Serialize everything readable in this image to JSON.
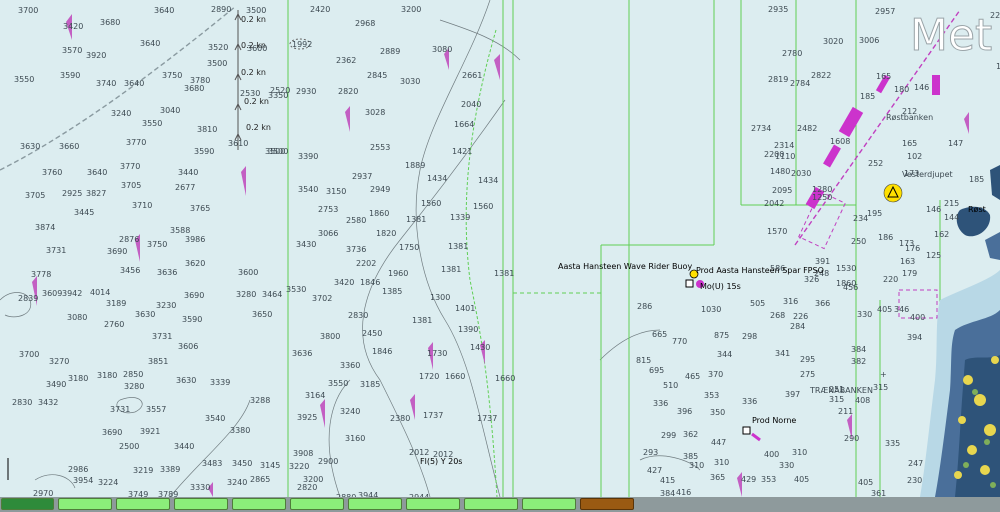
{
  "map": {
    "watermark": "Met",
    "features": {
      "buoy_label": "Aasta Hansteen Wave Rider Buoy",
      "fpso_label": "Prod Aasta Hansteen Spar FPSO",
      "light_label": "Mo(U)  15s",
      "norne_label": "Prod Norne",
      "light2_label": "Fl(5) Y 20s",
      "bank1": "Røstbanken",
      "bank2": "Vesterdjupet",
      "bank3": "TRÆNABANKEN",
      "rost": "Røst",
      "area_1992": "1992"
    },
    "currents": [
      "0.2 kn",
      "0.2 kn",
      "0.2 kn",
      "0.2 kn",
      "0.2 kn"
    ],
    "soundings": [
      [
        "3700",
        18,
        7
      ],
      [
        "3680",
        100,
        19
      ],
      [
        "3640",
        154,
        7
      ],
      [
        "2890",
        211,
        6
      ],
      [
        "3420",
        63,
        23
      ],
      [
        "3570",
        62,
        47
      ],
      [
        "3920",
        86,
        52
      ],
      [
        "3640",
        140,
        40
      ],
      [
        "3520",
        208,
        44
      ],
      [
        "3500",
        207,
        60
      ],
      [
        "3550",
        14,
        76
      ],
      [
        "3590",
        60,
        72
      ],
      [
        "3740",
        96,
        80
      ],
      [
        "3640",
        124,
        80
      ],
      [
        "3750",
        162,
        72
      ],
      [
        "3780",
        190,
        77
      ],
      [
        "3680",
        184,
        85
      ],
      [
        "2930",
        296,
        88
      ],
      [
        "2820",
        338,
        88
      ],
      [
        "3028",
        365,
        109
      ],
      [
        "2968",
        355,
        20
      ],
      [
        "3200",
        401,
        6
      ],
      [
        "2420",
        310,
        6
      ],
      [
        "2362",
        336,
        57
      ],
      [
        "2889",
        380,
        48
      ],
      [
        "2845",
        367,
        72
      ],
      [
        "3030",
        400,
        78
      ],
      [
        "3080",
        432,
        46
      ],
      [
        "2661",
        462,
        72
      ],
      [
        "2040",
        461,
        101
      ],
      [
        "1664",
        454,
        121
      ],
      [
        "1421",
        452,
        148
      ],
      [
        "1434",
        478,
        177
      ],
      [
        "1434",
        427,
        175
      ],
      [
        "1889",
        405,
        162
      ],
      [
        "2553",
        370,
        144
      ],
      [
        "3390",
        298,
        153
      ],
      [
        "3500",
        268,
        148
      ],
      [
        "3540",
        298,
        186
      ],
      [
        "3150",
        326,
        188
      ],
      [
        "2949",
        370,
        186
      ],
      [
        "2937",
        352,
        173
      ],
      [
        "1560",
        421,
        200
      ],
      [
        "1339",
        450,
        214
      ],
      [
        "1560",
        473,
        203
      ],
      [
        "1381",
        406,
        216
      ],
      [
        "1860",
        369,
        210
      ],
      [
        "2753",
        318,
        206
      ],
      [
        "2580",
        346,
        217
      ],
      [
        "1820",
        376,
        230
      ],
      [
        "3066",
        318,
        230
      ],
      [
        "3430",
        296,
        241
      ],
      [
        "3736",
        346,
        246
      ],
      [
        "1750",
        399,
        244
      ],
      [
        "1381",
        448,
        243
      ],
      [
        "2202",
        356,
        260
      ],
      [
        "1960",
        388,
        270
      ],
      [
        "1381",
        441,
        266
      ],
      [
        "1381",
        494,
        270
      ],
      [
        "3420",
        334,
        279
      ],
      [
        "1846",
        360,
        279
      ],
      [
        "1385",
        382,
        288
      ],
      [
        "3702",
        312,
        295
      ],
      [
        "1300",
        430,
        294
      ],
      [
        "2830",
        348,
        312
      ],
      [
        "1401",
        455,
        305
      ],
      [
        "1381",
        412,
        317
      ],
      [
        "2450",
        362,
        330
      ],
      [
        "1390",
        458,
        326
      ],
      [
        "3800",
        320,
        333
      ],
      [
        "1846",
        372,
        348
      ],
      [
        "1430",
        470,
        344
      ],
      [
        "3636",
        292,
        350
      ],
      [
        "3360",
        340,
        362
      ],
      [
        "1730",
        427,
        350
      ],
      [
        "1720",
        419,
        373
      ],
      [
        "1660",
        445,
        373
      ],
      [
        "1660",
        495,
        375
      ],
      [
        "3550",
        328,
        380
      ],
      [
        "3185",
        360,
        381
      ],
      [
        "3164",
        305,
        392
      ],
      [
        "2380",
        390,
        415
      ],
      [
        "1737",
        423,
        412
      ],
      [
        "1737",
        477,
        415
      ],
      [
        "3925",
        297,
        414
      ],
      [
        "3240",
        340,
        408
      ],
      [
        "3160",
        345,
        435
      ],
      [
        "2012",
        409,
        449
      ],
      [
        "2012",
        433,
        451
      ],
      [
        "3908",
        293,
        450
      ],
      [
        "2900",
        318,
        458
      ],
      [
        "3500",
        246,
        7
      ],
      [
        "3600",
        247,
        45
      ],
      [
        "2520",
        270,
        87
      ],
      [
        "2530",
        240,
        90
      ],
      [
        "3350",
        268,
        92
      ],
      [
        "3040",
        160,
        107
      ],
      [
        "3550",
        142,
        120
      ],
      [
        "3810",
        197,
        126
      ],
      [
        "3240",
        111,
        110
      ],
      [
        "3590",
        194,
        148
      ],
      [
        "3610",
        228,
        140
      ],
      [
        "3770",
        126,
        139
      ],
      [
        "3630",
        20,
        143
      ],
      [
        "3660",
        59,
        143
      ],
      [
        "3500",
        265,
        148
      ],
      [
        "3760",
        42,
        169
      ],
      [
        "3640",
        87,
        169
      ],
      [
        "3770",
        120,
        163
      ],
      [
        "3440",
        178,
        169
      ],
      [
        "3705",
        121,
        182
      ],
      [
        "2677",
        175,
        184
      ],
      [
        "2925",
        62,
        190
      ],
      [
        "3827",
        86,
        190
      ],
      [
        "3705",
        25,
        192
      ],
      [
        "3710",
        132,
        202
      ],
      [
        "3765",
        190,
        205
      ],
      [
        "3445",
        74,
        209
      ],
      [
        "3874",
        35,
        224
      ],
      [
        "3588",
        170,
        227
      ],
      [
        "2876",
        119,
        236
      ],
      [
        "3750",
        147,
        241
      ],
      [
        "3986",
        185,
        236
      ],
      [
        "3731",
        46,
        247
      ],
      [
        "3690",
        107,
        248
      ],
      [
        "3620",
        185,
        260
      ],
      [
        "3600",
        238,
        269
      ],
      [
        "3456",
        120,
        267
      ],
      [
        "3636",
        157,
        269
      ],
      [
        "3778",
        31,
        271
      ],
      [
        "3690",
        184,
        292
      ],
      [
        "3280",
        236,
        291
      ],
      [
        "3464",
        262,
        291
      ],
      [
        "3942",
        62,
        290
      ],
      [
        "4014",
        90,
        289
      ],
      [
        "2839",
        18,
        295
      ],
      [
        "3609",
        42,
        290
      ],
      [
        "3189",
        106,
        300
      ],
      [
        "3230",
        156,
        302
      ],
      [
        "3080",
        67,
        314
      ],
      [
        "2760",
        104,
        321
      ],
      [
        "3630",
        135,
        311
      ],
      [
        "3590",
        182,
        316
      ],
      [
        "3650",
        252,
        311
      ],
      [
        "3530",
        286,
        286
      ],
      [
        "3731",
        152,
        333
      ],
      [
        "3606",
        178,
        343
      ],
      [
        "3700",
        19,
        351
      ],
      [
        "3270",
        49,
        358
      ],
      [
        "3180",
        68,
        375
      ],
      [
        "3851",
        148,
        358
      ],
      [
        "3490",
        46,
        381
      ],
      [
        "3630",
        176,
        377
      ],
      [
        "3339",
        210,
        379
      ],
      [
        "2850",
        123,
        371
      ],
      [
        "3180",
        97,
        372
      ],
      [
        "2830",
        12,
        399
      ],
      [
        "3432",
        38,
        399
      ],
      [
        "3280",
        124,
        383
      ],
      [
        "3288",
        250,
        397
      ],
      [
        "3731",
        110,
        406
      ],
      [
        "3557",
        146,
        406
      ],
      [
        "3540",
        205,
        415
      ],
      [
        "3921",
        140,
        428
      ],
      [
        "3380",
        230,
        427
      ],
      [
        "3690",
        102,
        429
      ],
      [
        "2500",
        119,
        443
      ],
      [
        "3440",
        174,
        443
      ],
      [
        "3483",
        202,
        460
      ],
      [
        "3450",
        232,
        460
      ],
      [
        "3145",
        260,
        462
      ],
      [
        "3220",
        289,
        463
      ],
      [
        "3219",
        133,
        467
      ],
      [
        "3389",
        160,
        466
      ],
      [
        "3240",
        227,
        479
      ],
      [
        "2986",
        68,
        466
      ],
      [
        "3954",
        73,
        477
      ],
      [
        "3224",
        98,
        479
      ],
      [
        "3749",
        128,
        491
      ],
      [
        "3789",
        158,
        491
      ],
      [
        "3330",
        190,
        484
      ],
      [
        "2970",
        33,
        490
      ],
      [
        "2820",
        297,
        484
      ],
      [
        "2880",
        336,
        494
      ],
      [
        "3944",
        358,
        492
      ],
      [
        "2944",
        409,
        494
      ],
      [
        "2865",
        250,
        476
      ],
      [
        "3200",
        303,
        476
      ],
      [
        "2935",
        768,
        6
      ],
      [
        "2780",
        782,
        50
      ],
      [
        "3020",
        823,
        38
      ],
      [
        "3006",
        859,
        37
      ],
      [
        "2957",
        875,
        8
      ],
      [
        "2819",
        768,
        76
      ],
      [
        "2822",
        811,
        72
      ],
      [
        "2784",
        790,
        80
      ],
      [
        "2734",
        751,
        125
      ],
      [
        "2482",
        797,
        125
      ],
      [
        "2314",
        774,
        142
      ],
      [
        "2200",
        764,
        151
      ],
      [
        "1480",
        770,
        168
      ],
      [
        "2030",
        791,
        170
      ],
      [
        "1608",
        830,
        138
      ],
      [
        "1280",
        812,
        186
      ],
      [
        "1250",
        812,
        194
      ],
      [
        "2095",
        772,
        187
      ],
      [
        "2042",
        764,
        200
      ],
      [
        "1570",
        767,
        228
      ],
      [
        "1110",
        775,
        153
      ],
      [
        "1530",
        836,
        265
      ],
      [
        "1860",
        836,
        280
      ],
      [
        "391",
        815,
        258
      ],
      [
        "234",
        853,
        215
      ],
      [
        "250",
        851,
        238
      ],
      [
        "248",
        814,
        270
      ],
      [
        "326",
        804,
        276
      ],
      [
        "586",
        770,
        265
      ],
      [
        "456",
        843,
        284
      ],
      [
        "316",
        783,
        298
      ],
      [
        "366",
        815,
        300
      ],
      [
        "286",
        637,
        303
      ],
      [
        "505",
        750,
        300
      ],
      [
        "1030",
        701,
        306
      ],
      [
        "268",
        770,
        312
      ],
      [
        "226",
        793,
        313
      ],
      [
        "284",
        790,
        323
      ],
      [
        "330",
        857,
        311
      ],
      [
        "405",
        877,
        306
      ],
      [
        "346",
        894,
        306
      ],
      [
        "394",
        907,
        334
      ],
      [
        "400",
        910,
        314
      ],
      [
        "665",
        652,
        331
      ],
      [
        "875",
        714,
        332
      ],
      [
        "298",
        742,
        333
      ],
      [
        "770",
        672,
        338
      ],
      [
        "344",
        717,
        351
      ],
      [
        "295",
        800,
        356
      ],
      [
        "384",
        851,
        346
      ],
      [
        "382",
        851,
        358
      ],
      [
        "815",
        636,
        357
      ],
      [
        "695",
        649,
        367
      ],
      [
        "465",
        685,
        373
      ],
      [
        "370",
        708,
        371
      ],
      [
        "341",
        775,
        350
      ],
      [
        "275",
        800,
        371
      ],
      [
        "510",
        663,
        382
      ],
      [
        "353",
        704,
        392
      ],
      [
        "397",
        785,
        391
      ],
      [
        "251",
        829,
        386
      ],
      [
        "336",
        653,
        400
      ],
      [
        "396",
        677,
        408
      ],
      [
        "350",
        710,
        409
      ],
      [
        "336",
        742,
        398
      ],
      [
        "315",
        829,
        396
      ],
      [
        "211",
        838,
        408
      ],
      [
        "408",
        855,
        397
      ],
      [
        "315",
        873,
        384
      ],
      [
        "299",
        661,
        432
      ],
      [
        "362",
        683,
        431
      ],
      [
        "447",
        711,
        439
      ],
      [
        "293",
        643,
        449
      ],
      [
        "310",
        689,
        462
      ],
      [
        "427",
        647,
        467
      ],
      [
        "385",
        683,
        453
      ],
      [
        "310",
        714,
        459
      ],
      [
        "415",
        660,
        477
      ],
      [
        "416",
        676,
        489
      ],
      [
        "384",
        660,
        490
      ],
      [
        "365",
        710,
        474
      ],
      [
        "429",
        741,
        476
      ],
      [
        "353",
        761,
        476
      ],
      [
        "405",
        794,
        476
      ],
      [
        "310",
        792,
        449
      ],
      [
        "330",
        779,
        462
      ],
      [
        "400",
        764,
        451
      ],
      [
        "290",
        844,
        435
      ],
      [
        "335",
        885,
        440
      ],
      [
        "405",
        858,
        479
      ],
      [
        "361",
        871,
        490
      ],
      [
        "247",
        908,
        460
      ],
      [
        "230",
        907,
        477
      ],
      [
        "185",
        860,
        93
      ],
      [
        "165",
        876,
        73
      ],
      [
        "252",
        868,
        160
      ],
      [
        "180",
        894,
        86
      ],
      [
        "146",
        914,
        84
      ],
      [
        "212",
        902,
        108
      ],
      [
        "165",
        902,
        140
      ],
      [
        "102",
        907,
        153
      ],
      [
        "147",
        948,
        140
      ],
      [
        "173",
        904,
        170
      ],
      [
        "146",
        926,
        206
      ],
      [
        "215",
        944,
        200
      ],
      [
        "144",
        944,
        214
      ],
      [
        "185",
        969,
        176
      ],
      [
        "162",
        934,
        231
      ],
      [
        "173",
        899,
        240
      ],
      [
        "186",
        878,
        234
      ],
      [
        "125",
        926,
        252
      ],
      [
        "176",
        905,
        245
      ],
      [
        "163",
        900,
        258
      ],
      [
        "179",
        902,
        270
      ],
      [
        "220",
        883,
        276
      ],
      [
        "195",
        867,
        210
      ],
      [
        "226",
        990,
        12
      ],
      [
        "175",
        996,
        63
      ]
    ]
  }
}
